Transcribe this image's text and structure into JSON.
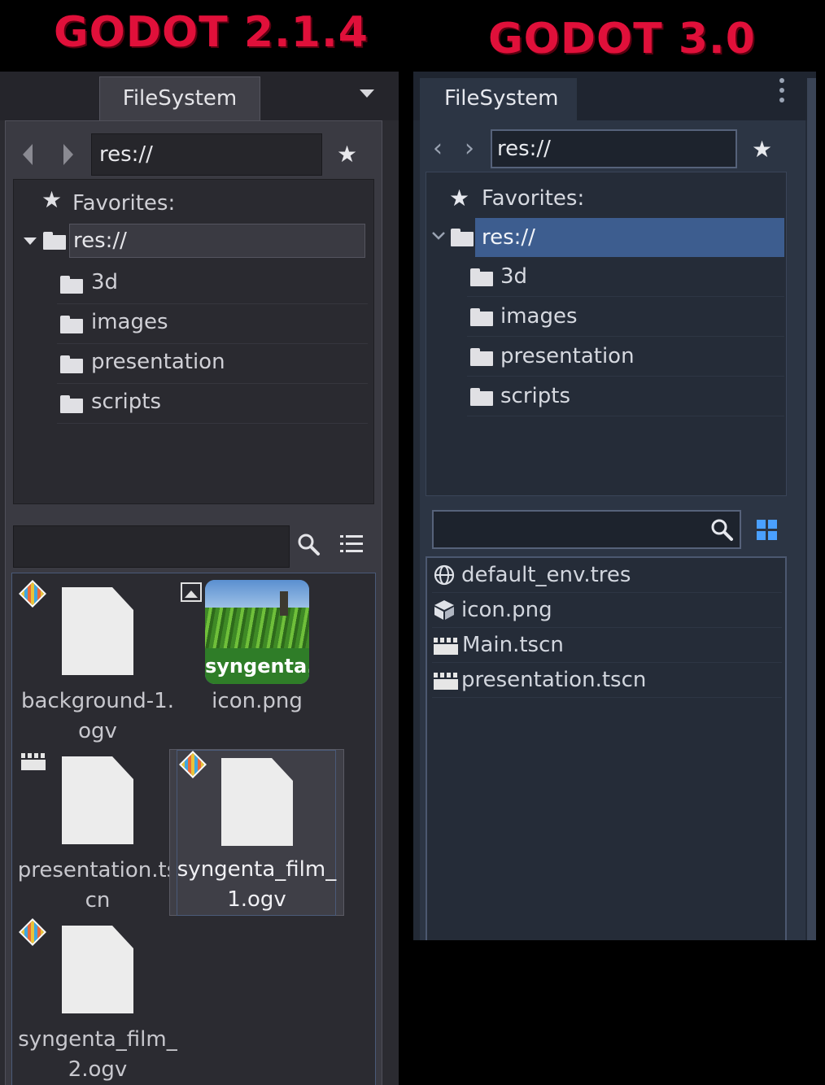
{
  "headlines": {
    "left": "GODOT 2.1.4",
    "right": "GODOT 3.0"
  },
  "colors": {
    "headline": "#e0103a",
    "accent_3": "#3d5d8f",
    "accent_2": "#4a5a78",
    "grid_icon": "#4aa0ff"
  },
  "godot2": {
    "tab_label": "FileSystem",
    "path": "res://",
    "tree": {
      "favorites_label": "Favorites:",
      "root_label": "res://",
      "folders": [
        "3d",
        "images",
        "presentation",
        "scripts"
      ]
    },
    "search_value": "",
    "files": [
      {
        "caption_line1": "background-1.",
        "caption_line2": "ogv",
        "type_icon": "video-icon"
      },
      {
        "caption_line1": "icon.png",
        "caption_line2": "",
        "type_icon": "image-icon"
      },
      {
        "caption_line1": "presentation.ts",
        "caption_line2": "cn",
        "type_icon": "scene-icon"
      },
      {
        "caption_line1": "syngenta_film_",
        "caption_line2": "1.ogv",
        "type_icon": "video-icon",
        "selected": true
      },
      {
        "caption_line1": "syngenta_film_",
        "caption_line2": "2.ogv",
        "type_icon": "video-icon"
      }
    ],
    "thumbnail_logo": "syngenta."
  },
  "godot3": {
    "tab_label": "FileSystem",
    "path": "res://",
    "tree": {
      "favorites_label": "Favorites:",
      "root_label": "res://",
      "folders": [
        "3d",
        "images",
        "presentation",
        "scripts"
      ]
    },
    "search_value": "",
    "files": [
      {
        "label": "default_env.tres",
        "icon": "globe-icon"
      },
      {
        "label": "icon.png",
        "icon": "cube-icon"
      },
      {
        "label": "Main.tscn",
        "icon": "clapperboard-icon"
      },
      {
        "label": "presentation.tscn",
        "icon": "clapperboard-icon"
      }
    ]
  }
}
